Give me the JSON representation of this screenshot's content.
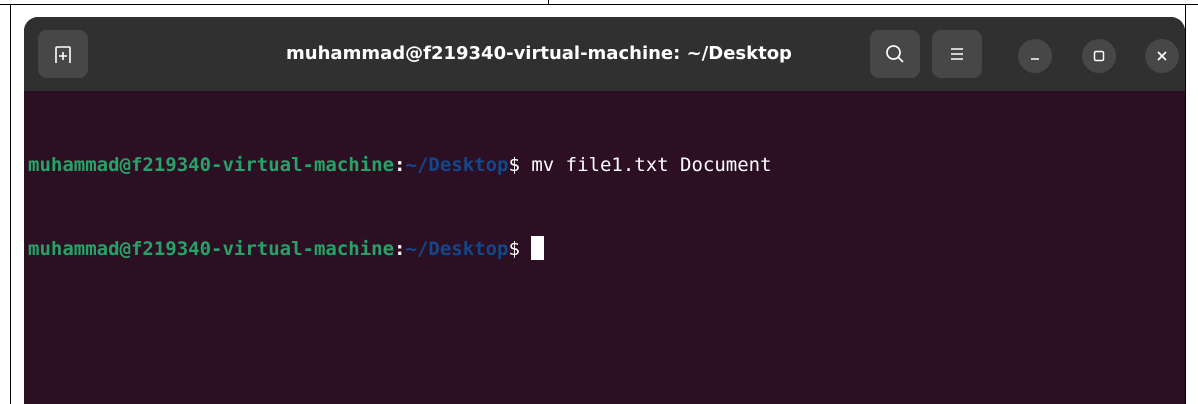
{
  "window": {
    "title": "muhammad@f219340-virtual-machine: ~/Desktop"
  },
  "colors": {
    "background": "#2c0f22",
    "titlebar": "#303030",
    "button": "#474747",
    "prompt_user": "#26a269",
    "prompt_path": "#12488b",
    "text": "#ffffff"
  },
  "icons": {
    "new_tab": "new-tab-icon",
    "search": "search-icon",
    "menu": "hamburger-menu-icon",
    "minimize": "minimize-icon",
    "maximize": "maximize-icon",
    "close": "close-icon"
  },
  "terminal": {
    "lines": [
      {
        "user_host": "muhammad@f219340-virtual-machine",
        "colon": ":",
        "path": "~/Desktop",
        "dollar": "$",
        "command": " mv file1.txt Document"
      },
      {
        "user_host": "muhammad@f219340-virtual-machine",
        "colon": ":",
        "path": "~/Desktop",
        "dollar": "$",
        "command": " "
      }
    ]
  }
}
